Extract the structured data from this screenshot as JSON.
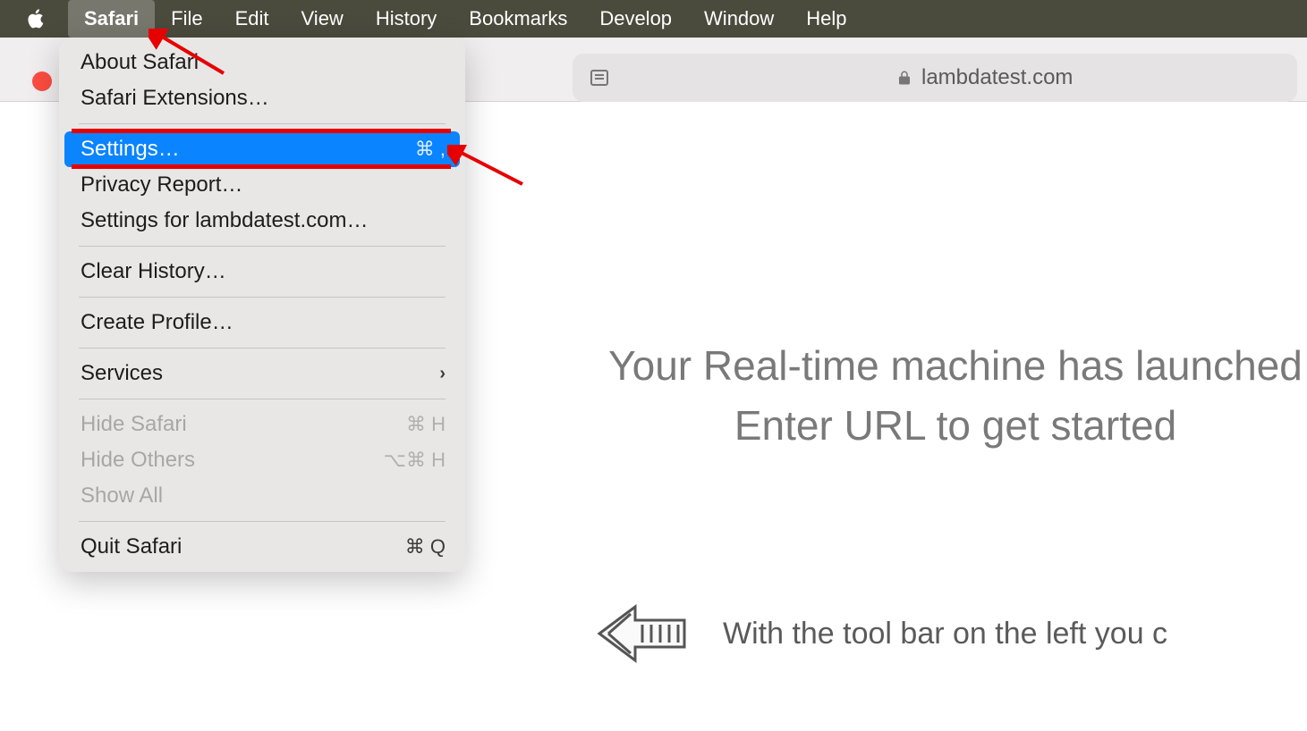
{
  "menubar": {
    "items": [
      "Safari",
      "File",
      "Edit",
      "View",
      "History",
      "Bookmarks",
      "Develop",
      "Window",
      "Help"
    ],
    "active_index": 0
  },
  "toolbar": {
    "url_display": "lambdatest.com"
  },
  "dropdown": {
    "about": "About Safari",
    "extensions": "Safari Extensions…",
    "settings": "Settings…",
    "settings_shortcut": "⌘ ,",
    "privacy_report": "Privacy Report…",
    "settings_for_site": "Settings for lambdatest.com…",
    "clear_history": "Clear History…",
    "create_profile": "Create Profile…",
    "services": "Services",
    "hide_safari": "Hide Safari",
    "hide_safari_shortcut": "⌘ H",
    "hide_others": "Hide Others",
    "hide_others_shortcut": "⌥⌘ H",
    "show_all": "Show All",
    "quit": "Quit Safari",
    "quit_shortcut": "⌘ Q"
  },
  "page": {
    "hero": "Your Real-time machine has launched Enter URL to get started",
    "sub": "With the tool bar on the left you c"
  }
}
